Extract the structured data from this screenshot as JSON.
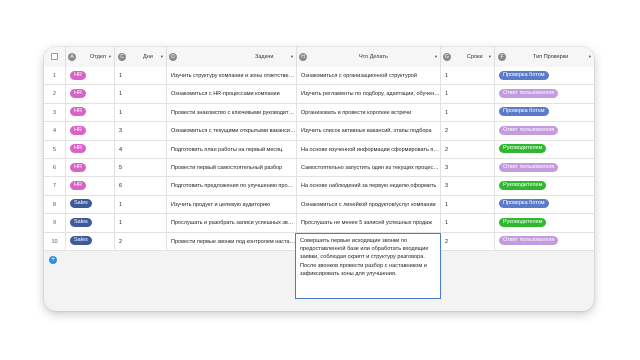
{
  "columns": [
    {
      "letter": "A",
      "label": "Отдел"
    },
    {
      "letter": "C",
      "label": "Дни"
    },
    {
      "letter": "D",
      "label": "Задачи"
    },
    {
      "letter": "H",
      "label": "Что Делать"
    },
    {
      "letter": "G",
      "label": "Сроки"
    },
    {
      "letter": "F",
      "label": "Тип Проверки"
    }
  ],
  "header_menu_glyph": "▾",
  "add_button_glyph": "+",
  "rows": [
    {
      "n": "1",
      "dept": "HR",
      "day": "1",
      "task": "Изучить структуру компании и зоны ответственности",
      "todo": "Ознакомиться с организационной структурой",
      "term": "1",
      "check": "Проверка ботом"
    },
    {
      "n": "2",
      "dept": "HR",
      "day": "1",
      "task": "Ознакомиться с HR-процессами компании",
      "todo": "Изучить регламенты по подбору, адаптации, обучению",
      "term": "1",
      "check": "Ответ пользователя"
    },
    {
      "n": "3",
      "dept": "HR",
      "day": "1",
      "task": "Провести знакомство с ключевыми руководителями",
      "todo": "Организовать и провести короткие встречи",
      "term": "1",
      "check": "Проверка ботом"
    },
    {
      "n": "4",
      "dept": "HR",
      "day": "3",
      "task": "Ознакомиться с текущими открытыми вакансиями",
      "todo": "Изучить список активных вакансий, этапы подбора",
      "term": "2",
      "check": "Ответ пользователя"
    },
    {
      "n": "5",
      "dept": "HR",
      "day": "4",
      "task": "Подготовить план работы на первый месяц",
      "todo": "На основе изученной информации сформировать план",
      "term": "2",
      "check": "Руководителем"
    },
    {
      "n": "6",
      "dept": "HR",
      "day": "5",
      "task": "Провести первый самостоятельный разбор",
      "todo": "Самостоятельно запустить один из текущих процессов",
      "term": "3",
      "check": "Ответ пользователя"
    },
    {
      "n": "7",
      "dept": "HR",
      "day": "6",
      "task": "Подготовить предложения по улучшению процессов",
      "todo": "На основе наблюдений за первую неделю оформить",
      "term": "3",
      "check": "Руководителем"
    },
    {
      "n": "8",
      "dept": "Sales",
      "day": "1",
      "task": "Изучить продукт и целевую аудиторию",
      "todo": "Ознакомиться с линейкой продуктов/услуг компании",
      "term": "1",
      "check": "Проверка ботом"
    },
    {
      "n": "9",
      "dept": "Sales",
      "day": "1",
      "task": "Прослушать и разобрать записи успешных звонков",
      "todo": "Прослушать не менее 5 записей успешных продаж",
      "term": "1",
      "check": "Руководителем"
    },
    {
      "n": "10",
      "dept": "Sales",
      "day": "2",
      "task": "Провести первые звонки под контролем наставника",
      "todo": "Совершить первые исходящие звонки по предоставленной базе",
      "term": "2",
      "check": "Ответ пользователя"
    }
  ],
  "editor_text": "Совершить первые исходящие звонки по предоставленной базе или обработать входящие заявки, соблюдая скрипт и структуру разговора. После звонков провести разбор с наставником и зафиксировать зоны для улучшения.",
  "colors": {
    "hr": "#d962c9",
    "sales": "#3d5a9c",
    "bot": "#5b7bc8",
    "user": "#c49be0",
    "manager": "#2fb82f",
    "accent": "#2a8de0"
  }
}
